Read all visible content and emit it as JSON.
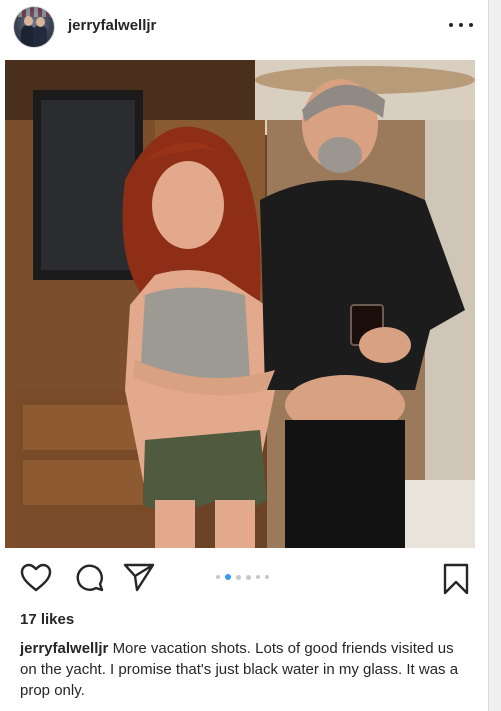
{
  "post": {
    "username": "jerryfalwelljr",
    "likes": "17 likes",
    "caption_user": "jerryfalwelljr",
    "caption_text": "More vacation shots.  Lots of good friends visited us on the yacht.  I promise that's just black water in my glass.  It was a prop only.",
    "carousel": {
      "total": 6,
      "active_index": 1
    }
  },
  "icons": {
    "more": "more-options-icon",
    "like": "heart-icon",
    "comment": "comment-icon",
    "share": "share-icon",
    "save": "bookmark-icon"
  },
  "colors": {
    "text": "#262626",
    "carousel_active": "#3897f0",
    "carousel_inactive": "#c7c7c7",
    "border": "#dbdbdb"
  }
}
